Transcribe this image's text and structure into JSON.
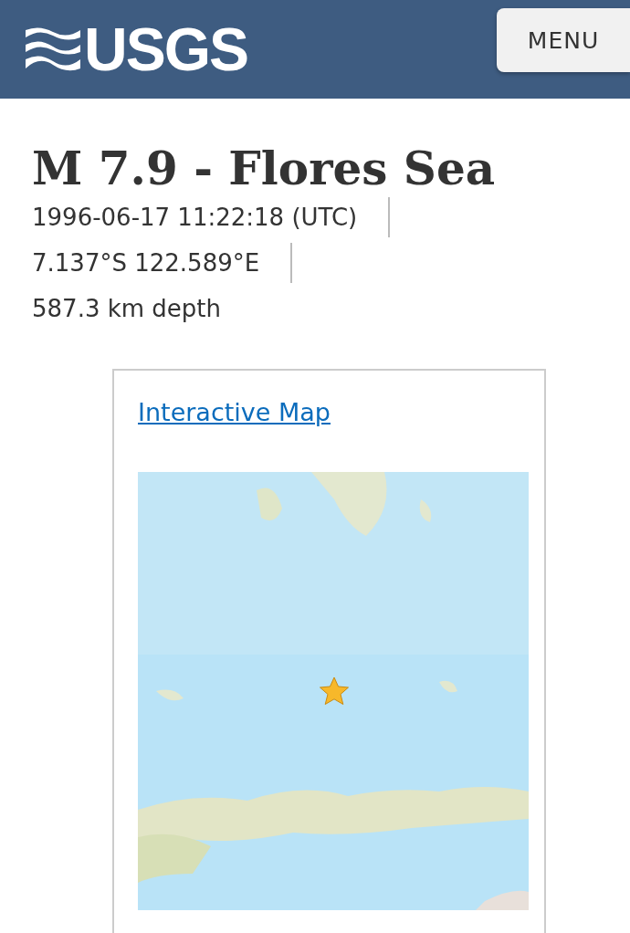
{
  "header": {
    "logo": "USGS",
    "menu_button": "MENU"
  },
  "event": {
    "title": "M 7.9 - Flores Sea",
    "details": [
      "1996-06-17 11:22:18 (UTC)",
      "7.137°S 122.589°E",
      "587.3 km depth"
    ]
  },
  "map_card": {
    "link": "Interactive Map"
  }
}
